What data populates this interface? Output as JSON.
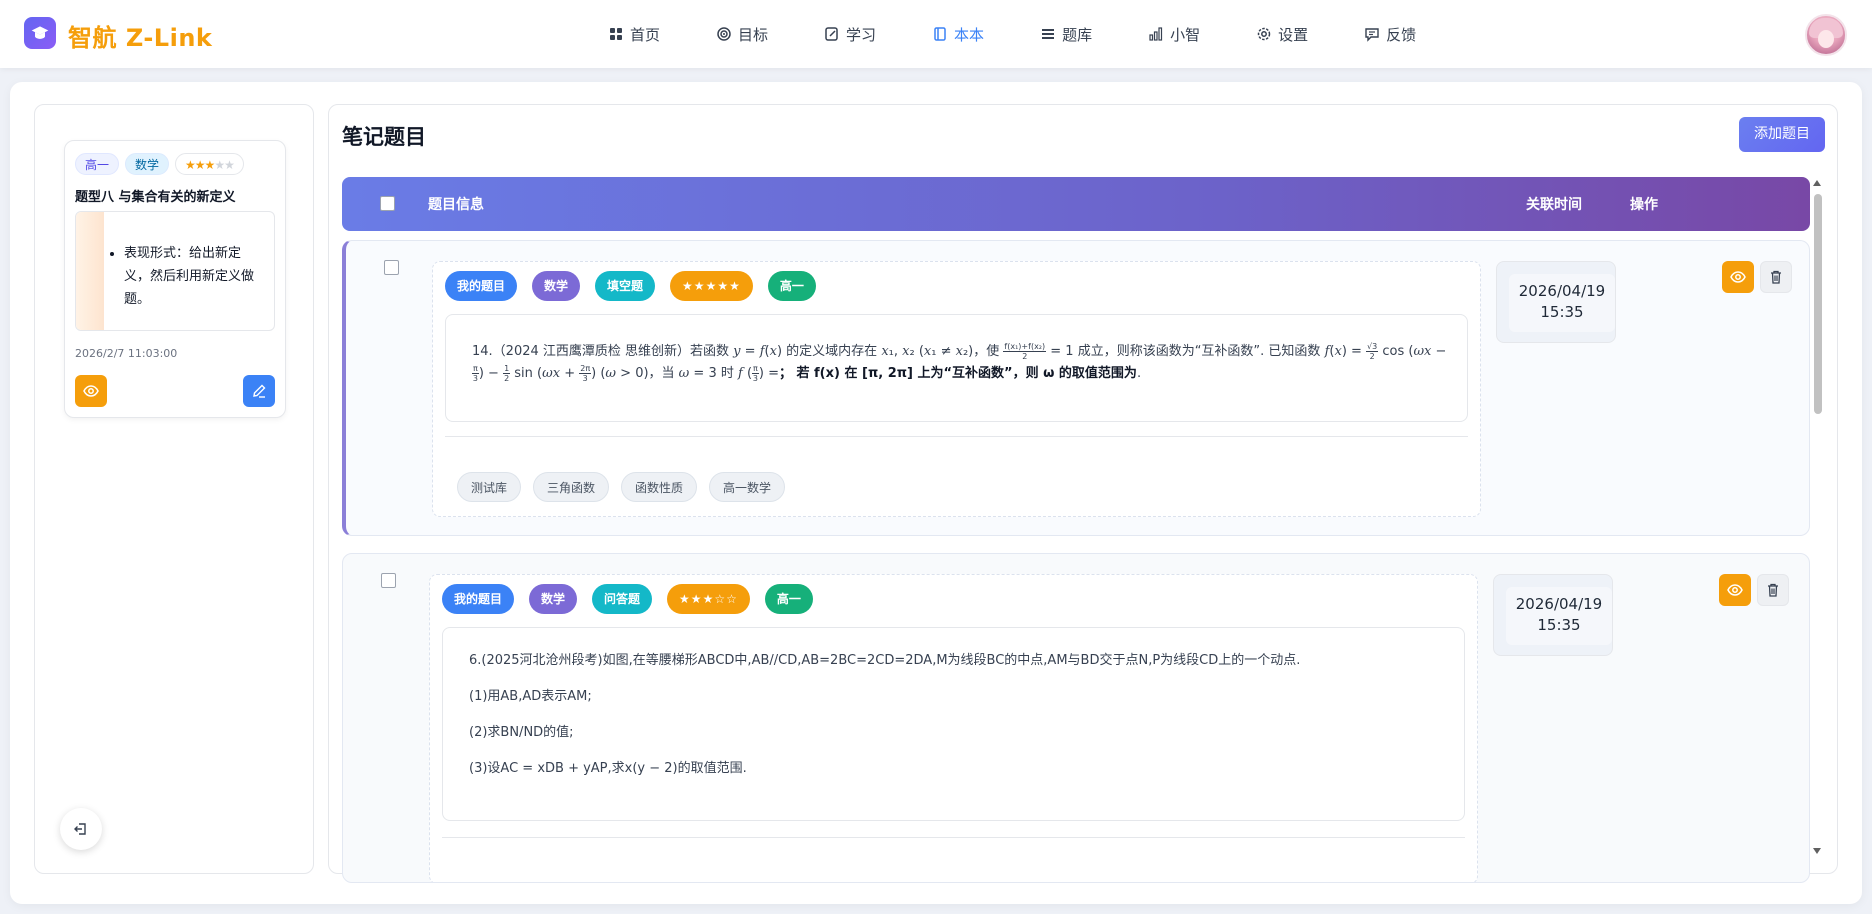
{
  "app": {
    "brand": "智航 Z-Link"
  },
  "nav": [
    {
      "label": "首页",
      "icon": "grid-icon",
      "active": false
    },
    {
      "label": "目标",
      "icon": "target-icon",
      "active": false
    },
    {
      "label": "学习",
      "icon": "edit-doc-icon",
      "active": false
    },
    {
      "label": "本本",
      "icon": "notebook-icon",
      "active": true
    },
    {
      "label": "题库",
      "icon": "list-icon",
      "active": false
    },
    {
      "label": "小智",
      "icon": "bar-chart-icon",
      "active": false
    },
    {
      "label": "设置",
      "icon": "gear-icon",
      "active": false
    },
    {
      "label": "反馈",
      "icon": "message-icon",
      "active": false
    }
  ],
  "left": {
    "card": {
      "tags": [
        "高一",
        "数学"
      ],
      "stars_filled": "★★★",
      "stars_empty": "★★",
      "title": "题型八 与集合有关的新定义",
      "preview_text": "表现形式：给出新定义，然后利用新定义做题。",
      "time": "2026/2/7 11:03:00"
    }
  },
  "main": {
    "title": "笔记题目",
    "add_button": "添加题目",
    "columns": {
      "info": "题目信息",
      "time": "关联时间",
      "op": "操作"
    },
    "rows": [
      {
        "tags": {
          "mine": "我的题目",
          "subject": "数学",
          "type": "填空题",
          "stars": "★★★★★",
          "grade": "高一"
        },
        "question_prefix": "14.（2024 江西鹰潭质检 思维创新）若函数",
        "question_mid": "的定义域内存在",
        "question_mid2": "，使",
        "question_mid3": "成立，则称该函数为“互补函数”. 已知函数",
        "question_tail": "时",
        "question_bold": "若 f(x) 在 [π, 2π] 上为“互补函数”，则 ω 的取值范围为",
        "keywords": [
          "测试库",
          "三角函数",
          "函数性质",
          "高一数学"
        ],
        "time": "2026/04/19\n15:35",
        "time_date": "2026/04/19",
        "time_clock": "15:35"
      },
      {
        "tags": {
          "mine": "我的题目",
          "subject": "数学",
          "type": "问答题",
          "stars": "★★★☆☆",
          "grade": "高一"
        },
        "lines": [
          "6.(2025河北沧州段考)如图,在等腰梯形ABCD中,AB//CD,AB=2BC=2CD=2DA,M为线段BC的中点,AM与BD交于点N,P为线段CD上的一个动点.",
          "(1)用AB,AD表示AM;",
          "(2)求BN/ND的值;",
          "(3)设AC = xDB + yAP,求x(y − 2)的取值范围."
        ],
        "time_date": "2026/04/19",
        "time_clock": "15:35"
      }
    ]
  },
  "colors": {
    "accent": "#6366f1",
    "brand": "#f59e0b",
    "active_nav": "#3b82f6"
  }
}
